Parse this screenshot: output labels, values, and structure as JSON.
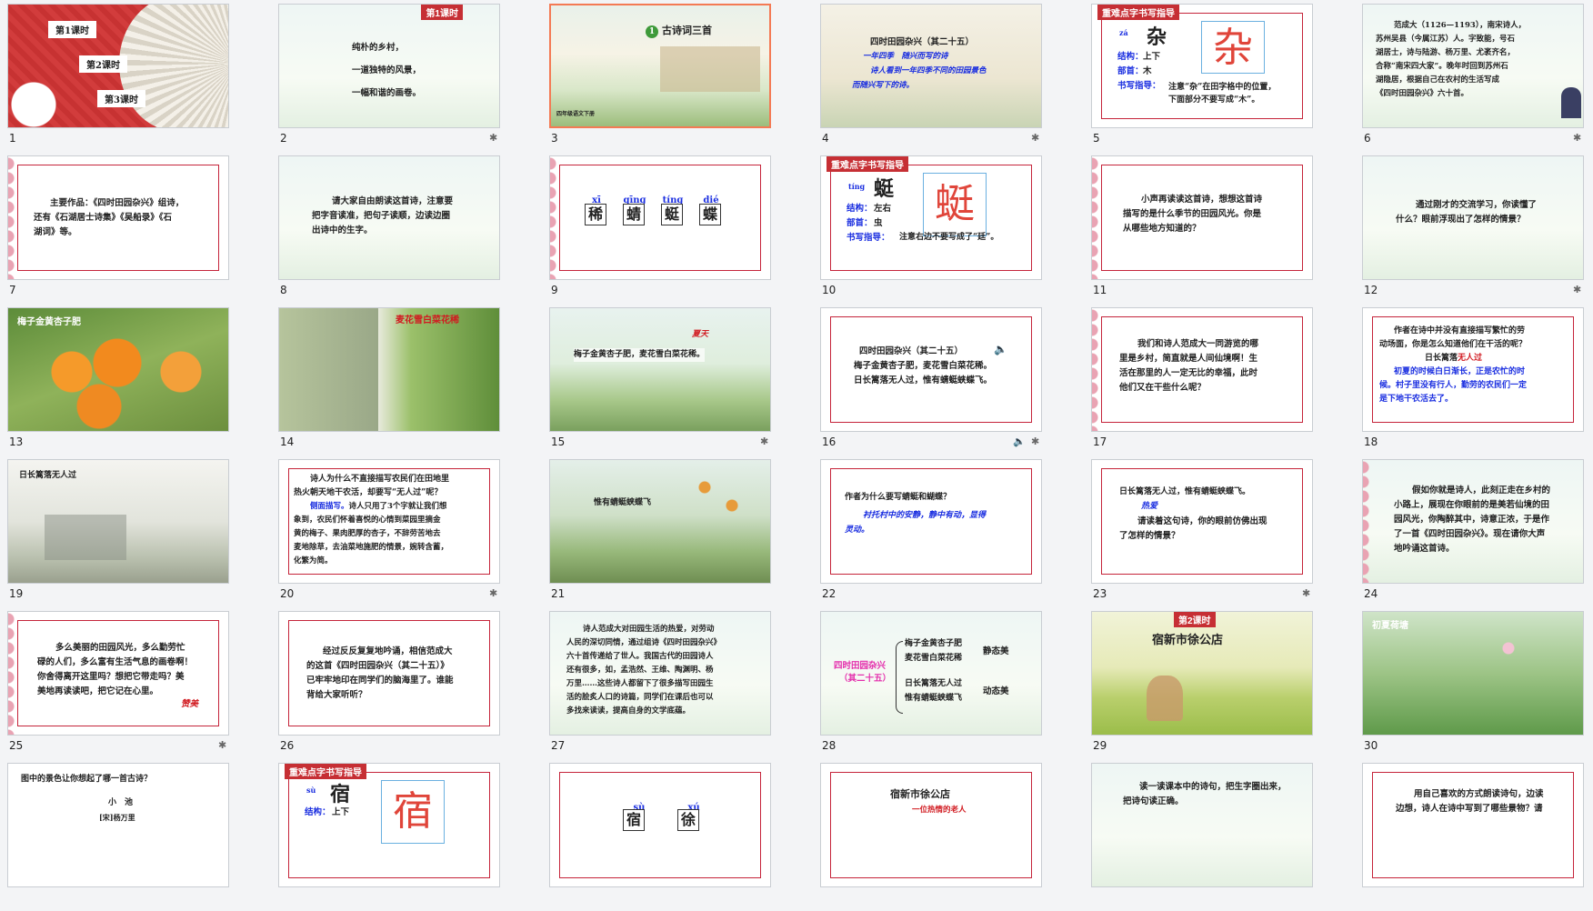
{
  "slides": [
    {
      "n": "1",
      "l1": "第1课时",
      "l2": "第2课时",
      "l3": "第3课时"
    },
    {
      "n": "2",
      "tag": "第1课时",
      "a": "纯朴的乡村，",
      "b": "一道独特的风景，",
      "c": "一幅和谐的画卷。"
    },
    {
      "n": "3",
      "title": "古诗词三首",
      "num": "1",
      "foot": "四年级语文下册"
    },
    {
      "n": "4",
      "title": "四时田园杂兴（其二十五）",
      "a": "一年四季　随兴而写的诗",
      "b": "诗人看到一年四季不同的田园景色",
      "c": "而随兴写下的诗。"
    },
    {
      "n": "5",
      "tag": "重难点字书写指导",
      "py": "zá",
      "ch": "杂",
      "big": "杂",
      "k1": "结构：",
      "v1": "上下",
      "k2": "部首：",
      "v2": "木",
      "k3": "书写指导：",
      "v3": "注意“杂”在田字格中的位置，",
      "v4": "下面部分不要写成“木”。"
    },
    {
      "n": "6",
      "t1": "范成大（1126—1193），南宋诗人，",
      "t2": "苏州吴县（今属江苏）人。字致能，号石",
      "t3": "湖居士，诗与陆游、杨万里、尤袤齐名，",
      "t4": "合称“南宋四大家”。晚年时回到苏州石",
      "t5": "湖隐居，根据自己在农村的生活写成",
      "t6": "《四时田园杂兴》六十首。"
    },
    {
      "n": "7",
      "t1": "主要作品：《四时田园杂兴》组诗，",
      "t2": "还有《石湖居士诗集》《吴船录》《石",
      "t3": "湖词》等。"
    },
    {
      "n": "8",
      "t1": "请大家自由朗读这首诗，注意要",
      "t2": "把字音读准，把句子读顺，边读边圈",
      "t3": "出诗中的生字。"
    },
    {
      "n": "9",
      "p1": "xī",
      "p2": "qīnɡ",
      "p3": "tínɡ",
      "p4": "dié",
      "c1": "稀",
      "c2": "蜻",
      "c3": "蜓",
      "c4": "蝶"
    },
    {
      "n": "10",
      "tag": "重难点字书写指导",
      "py": "tíng",
      "ch": "蜓",
      "big": "蜓",
      "k1": "结构：",
      "v1": "左右",
      "k2": "部首：",
      "v2": "虫",
      "k3": "书写指导：",
      "v3": "注意右边不要写成了“廷”。"
    },
    {
      "n": "11",
      "t1": "小声再读读这首诗，想想这首诗",
      "t2": "描写的是什么季节的田园风光。你是",
      "t3": "从哪些地方知道的？"
    },
    {
      "n": "12",
      "t1": "通过刚才的交流学习，你读懂了",
      "t2": "什么？眼前浮现出了怎样的情景？"
    },
    {
      "n": "13",
      "cap": "梅子金黄杏子肥"
    },
    {
      "n": "14",
      "cap": "麦花雪白菜花稀"
    },
    {
      "n": "15",
      "a": "夏天",
      "cap": "梅子金黄杏子肥，麦花雪白菜花稀。"
    },
    {
      "n": "16",
      "t1": "四时田园杂兴（其二十五）",
      "t2": "梅子金黄杏子肥，麦花雪白菜花稀。",
      "t3": "日长篱落无人过，惟有蜻蜓蛱蝶飞。"
    },
    {
      "n": "17",
      "t1": "我们和诗人范成大一同游览的哪",
      "t2": "里是乡村，简直就是人间仙境啊！生",
      "t3": "活在那里的人一定无比的幸福，此时",
      "t4": "他们又在干些什么呢？"
    },
    {
      "n": "18",
      "t1": "作者在诗中并没有直接描写繁忙的劳",
      "t2": "动场面，你是怎么知道他们在干活的呢？",
      "t3": "日长篱落",
      "t3r": "无人过",
      "t4": "初夏的时候白日渐长，正是农忙的时",
      "t5": "候。村子里没有行人，勤劳的农民们一定",
      "t6": "是下地干农活去了。"
    },
    {
      "n": "19",
      "cap": "日长篱落无人过"
    },
    {
      "n": "20",
      "t1": "诗人为什么不直接描写农民们在田地里",
      "t2": "热火朝天地干农活，却要写“无人过”呢？",
      "t3": "侧面描写。",
      "t3b": "诗人只用了3个字就让我们想",
      "t4": "象到，农民们怀着喜悦的心情到菜园里摘金",
      "t5": "黄的梅子、果肉肥厚的杏子，不辞劳苦地去",
      "t6": "麦地除草，去油菜地施肥的情景，婉转含蓄，",
      "t7": "化繁为简。"
    },
    {
      "n": "21",
      "cap": "惟有蜻蜓蛱蝶飞"
    },
    {
      "n": "22",
      "t1": "作者为什么要写蜻蜓和蝴蝶？",
      "t2": "衬托村中的安静，静中有动，显得",
      "t3": "灵动。"
    },
    {
      "n": "23",
      "t1": "日长篱落无人过，惟有蜻蜓蛱蝶飞。",
      "t2": "热爱",
      "t3": "请读着这句诗，你的眼前仿佛出现",
      "t4": "了怎样的情景？"
    },
    {
      "n": "24",
      "t1": "假如你就是诗人，此刻正走在乡村的",
      "t2": "小路上，展现在你眼前的是美若仙境的田",
      "t3": "园风光，你陶醉其中，诗意正浓，于是作",
      "t4": "了一首《四时田园杂兴》。现在请你大声",
      "t5": "地吟诵这首诗。"
    },
    {
      "n": "25",
      "t1": "多么美丽的田园风光，多么勤劳忙",
      "t2": "碌的人们，多么富有生活气息的画卷啊！",
      "t3": "你舍得离开这里吗？想把它带走吗？美",
      "t4": "美地再读读吧，把它记在心里。",
      "t5": "赞美"
    },
    {
      "n": "26",
      "t1": "经过反反复复地吟诵，相信范成大",
      "t2": "的这首《四时田园杂兴（其二十五）》",
      "t3": "已牢牢地印在同学们的脑海里了。谁能",
      "t4": "背给大家听听？"
    },
    {
      "n": "27",
      "t1": "诗人范成大对田园生活的热爱，对劳动",
      "t2": "人民的深切同情，通过组诗《四时田园杂兴》",
      "t3": "六十首传递给了世人。我国古代的田园诗人",
      "t4": "还有很多，如，孟浩然、王维、陶渊明、杨",
      "t5": "万里……这些诗人都留下了很多描写田园生",
      "t6": "活的脍炙人口的诗篇，同学们在课后也可以",
      "t7": "多找来读读，提高自身的文学底蕴。"
    },
    {
      "n": "28",
      "left1": "四时田园杂兴",
      "left2": "（其二十五）",
      "a1": "梅子金黄杏子肥",
      "a2": "麦花雪白菜花稀",
      "a3": "静态美",
      "b1": "日长篱落无人过",
      "b2": "惟有蜻蜓蛱蝶飞",
      "b3": "动态美"
    },
    {
      "n": "29",
      "tag": "第2课时",
      "title": "宿新市徐公店"
    },
    {
      "n": "30",
      "cap": "初夏荷塘"
    },
    {
      "n": "31",
      "t1": "图中的景色让你想起了哪一首古诗？",
      "t2": "小　池",
      "t3": "[宋]杨万里"
    },
    {
      "n": "32",
      "tag": "重难点字书写指导",
      "py": "sù",
      "ch": "宿",
      "big": "宿",
      "k1": "结构：",
      "v1": "上下"
    },
    {
      "n": "33",
      "p1": "sù",
      "p2": "xú",
      "c1": "宿",
      "c2": "徐"
    },
    {
      "n": "34",
      "t1": "宿新市徐公店",
      "t2": "一位热情的老人"
    },
    {
      "n": "35",
      "t1": "读一读课本中的诗句，把生字圈出来，",
      "t2": "把诗句读正确。"
    },
    {
      "n": "36",
      "t1": "用自己喜欢的方式朗读诗句，边读",
      "t2": "边想，诗人在诗中写到了哪些景物？请"
    }
  ],
  "icons": {
    "star": "star-icon",
    "speaker": "speaker-icon"
  },
  "colors": {
    "selected": "#f47a54",
    "accent": "#c62f34",
    "blue": "#1a2ee0"
  }
}
